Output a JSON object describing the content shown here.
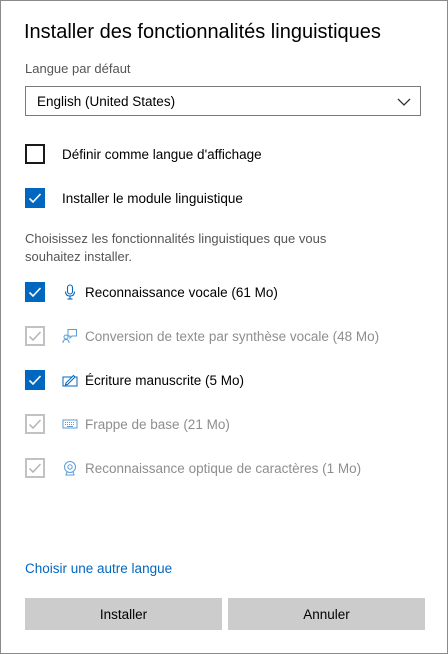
{
  "dialog": {
    "title": "Installer des fonctionnalités linguistiques",
    "default_language_label": "Langue par défaut",
    "default_language_value": "English (United States)",
    "options": [
      {
        "label": "Définir comme langue d'affichage",
        "checked": false
      },
      {
        "label": "Installer le module linguistique",
        "checked": true
      }
    ],
    "features_description": "Choisissez les fonctionnalités linguistiques que vous souhaitez installer.",
    "features": [
      {
        "icon": "microphone-icon",
        "label": "Reconnaissance vocale (61 Mo)",
        "checked": true,
        "disabled": false
      },
      {
        "icon": "speech-bubble-icon",
        "label": "Conversion de texte par synthèse vocale (48 Mo)",
        "checked": true,
        "disabled": true
      },
      {
        "icon": "pen-icon",
        "label": "Écriture manuscrite (5 Mo)",
        "checked": true,
        "disabled": false
      },
      {
        "icon": "keyboard-icon",
        "label": "Frappe de base (21 Mo)",
        "checked": true,
        "disabled": true
      },
      {
        "icon": "ocr-eye-icon",
        "label": "Reconnaissance optique de caractères (1 Mo)",
        "checked": true,
        "disabled": true
      }
    ],
    "choose_other_language_link": "Choisir une autre langue",
    "install_button": "Installer",
    "cancel_button": "Annuler"
  },
  "colors": {
    "accent": "#0067c0",
    "disabled_text": "#8e8e8e",
    "button_bg": "#cccccc"
  }
}
